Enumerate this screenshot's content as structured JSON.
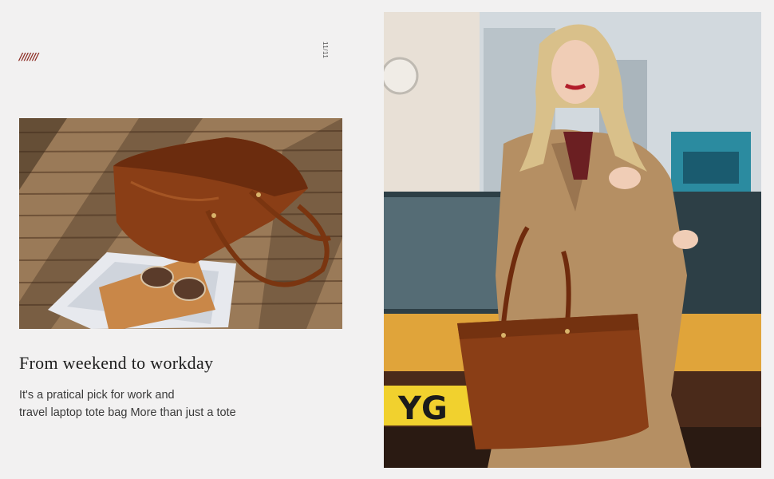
{
  "decor": {
    "slashes": "///////"
  },
  "page_counter": "11/11",
  "photos": {
    "left": {
      "name": "tote bag on wooden deck with sunglasses and notebook"
    },
    "right": {
      "name": "woman in trench coat holding brown leather tote",
      "plate_text": "YG"
    }
  },
  "content": {
    "heading": "From weekend to workday",
    "body_line1": "It's a pratical pick for work and",
    "body_line2": "travel laptop tote bag More than just a tote"
  },
  "colors": {
    "background": "#f2f1f1",
    "accent_slash": "#8c2b22",
    "leather": "#8a3e16"
  }
}
